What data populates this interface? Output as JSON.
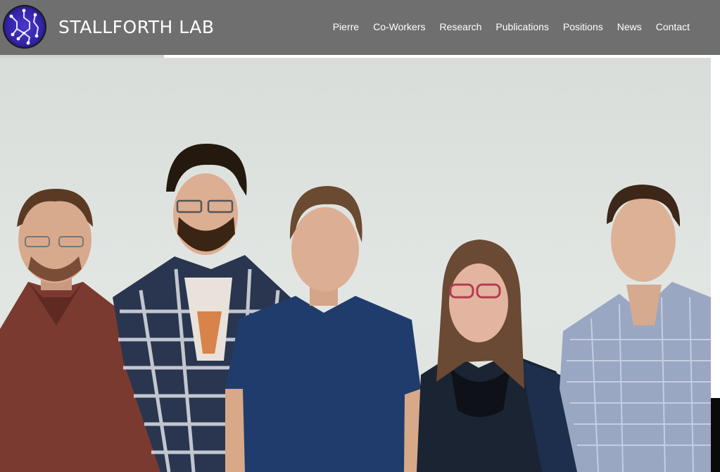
{
  "header": {
    "brand": "STALLFORTH LAB",
    "logo_icon": "molecule-logo-icon",
    "background": "#6f6f6f"
  },
  "nav": {
    "items": [
      {
        "label": "Pierre"
      },
      {
        "label": "Co-Workers"
      },
      {
        "label": "Research"
      },
      {
        "label": "Publications"
      },
      {
        "label": "Positions"
      },
      {
        "label": "News"
      },
      {
        "label": "Contact"
      }
    ]
  },
  "hero": {
    "image_icon": "group-photo-icon",
    "people_count": 5
  }
}
